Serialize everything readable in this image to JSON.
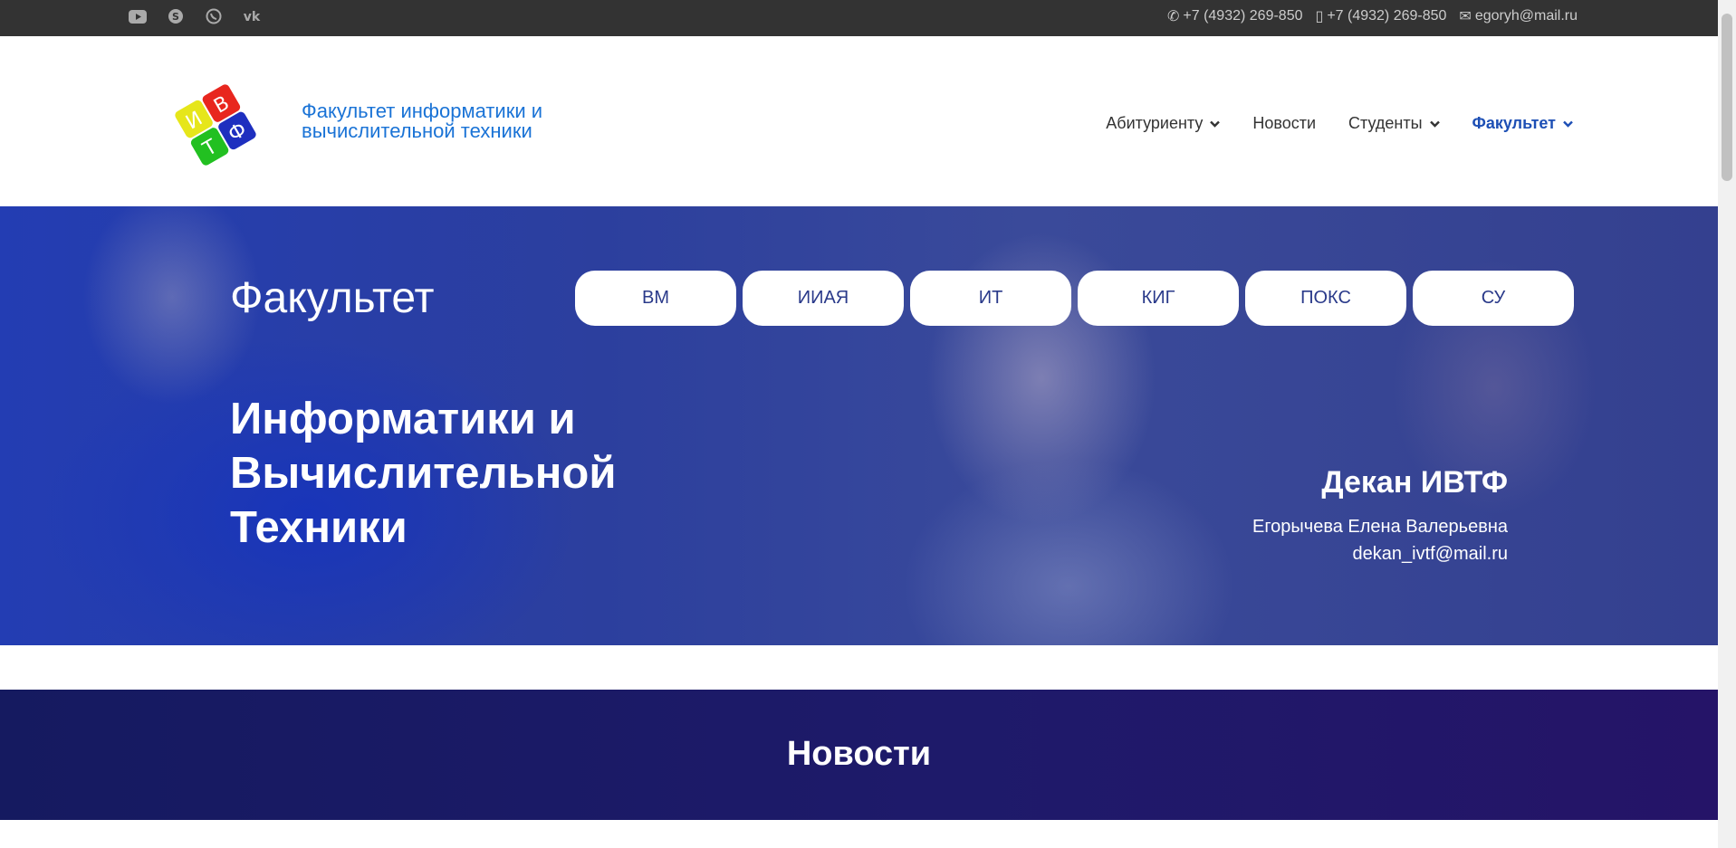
{
  "topbar": {
    "social": [
      "youtube-icon",
      "skype-icon",
      "whatsapp-icon",
      "vk-icon"
    ],
    "phone1": "+7 (4932) 269-850",
    "phone2": "+7 (4932) 269-850",
    "email": "egoryh@mail.ru"
  },
  "header": {
    "logo_letters": [
      "И",
      "В",
      "Т",
      "Ф"
    ],
    "site_title": "Факультет информатики и вычислительной техники",
    "nav": [
      {
        "label": "Абитуриенту",
        "dropdown": true
      },
      {
        "label": "Новости",
        "dropdown": false
      },
      {
        "label": "Студенты",
        "dropdown": true
      },
      {
        "label": "Факультет",
        "dropdown": true,
        "active": true
      }
    ]
  },
  "hero": {
    "title": "Факультет",
    "tabs": [
      "ВМ",
      "ИИАЯ",
      "ИТ",
      "КИГ",
      "ПОКС",
      "СУ"
    ],
    "big_line1": "Информатики и",
    "big_line2": "Вычислительной",
    "big_line3": "Техники",
    "dean_title": "Декан ИВТФ",
    "dean_name": "Егорычева Елена Валерьевна",
    "dean_email": "dekan_ivtf@mail.ru"
  },
  "news": {
    "title": "Новости"
  },
  "colors": {
    "topbar": "#333333",
    "accent": "#1a73d6",
    "hero": "#2c3f9e",
    "news_bg": "#1e1a6a"
  }
}
